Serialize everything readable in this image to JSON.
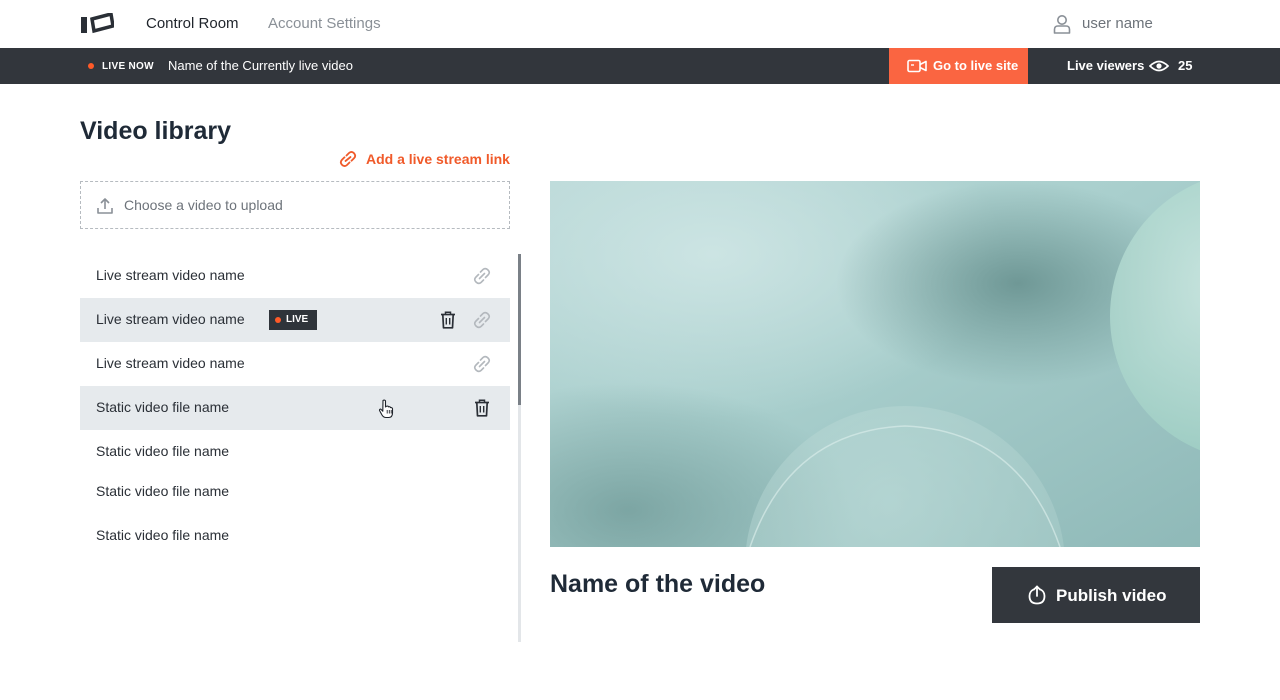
{
  "nav": {
    "links": [
      "Control Room",
      "Account Settings"
    ],
    "user_name": "user name"
  },
  "live_bar": {
    "status": "LIVE NOW",
    "title": "Name of the Currently live video",
    "go_live_label": "Go to live site",
    "viewers_label": "Live viewers",
    "viewers_count": "25"
  },
  "library": {
    "title": "Video library",
    "add_stream_label": "Add a live stream link",
    "upload_label": "Choose a video to upload",
    "live_badge": "LIVE",
    "items": [
      {
        "name": "Live stream video name",
        "type": "stream",
        "live": false,
        "selected": false
      },
      {
        "name": "Live stream video name",
        "type": "stream",
        "live": true,
        "selected": true
      },
      {
        "name": "Live stream video name",
        "type": "stream",
        "live": false,
        "selected": false
      },
      {
        "name": "Static video file name",
        "type": "static",
        "live": false,
        "selected": true
      },
      {
        "name": "Static video file name",
        "type": "static",
        "live": false,
        "selected": false
      },
      {
        "name": "Static video file name",
        "type": "static",
        "live": false,
        "selected": false
      },
      {
        "name": "Static video file name",
        "type": "static",
        "live": false,
        "selected": false
      }
    ]
  },
  "preview": {
    "video_title": "Name of the video",
    "publish_label": "Publish video"
  },
  "colors": {
    "accent": "#fa6541",
    "dark_bar": "#32363c",
    "selected_row": "#e6eaed",
    "live_dot": "#ff5a28"
  },
  "icons": [
    "logo-icon",
    "user-icon",
    "camera-icon",
    "eye-icon",
    "link-icon",
    "upload-icon",
    "trash-icon",
    "pointer-cursor-icon",
    "publish-icon"
  ]
}
